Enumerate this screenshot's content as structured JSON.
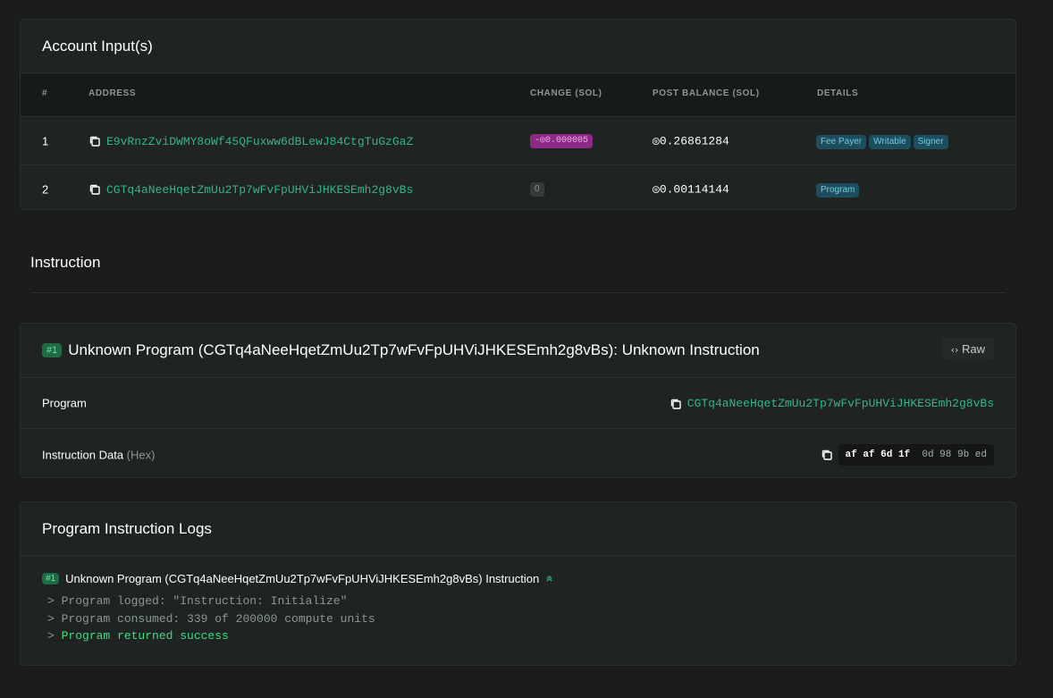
{
  "accounts": {
    "title": "Account Input(s)",
    "columns": [
      "#",
      "ADDRESS",
      "CHANGE (SOL)",
      "POST BALANCE (SOL)",
      "DETAILS"
    ],
    "rows": [
      {
        "index": "1",
        "address": "E9vRnzZviDWMY8oWf45QFuxww6dBLewJ84CtgTuGzGaZ",
        "change": "-◎0.000005",
        "post_balance": "◎0.26861284",
        "details": [
          "Fee Payer",
          "Writable",
          "Signer"
        ]
      },
      {
        "index": "2",
        "address": "CGTq4aNeeHqetZmUu2Tp7wFvFpUHViJHKESEmh2g8vBs",
        "change": "0",
        "post_balance": "◎0.00114144",
        "details": [
          "Program"
        ]
      }
    ]
  },
  "instruction_section": {
    "title": "Instruction"
  },
  "instruction": {
    "number": "#1",
    "title": "Unknown Program (CGTq4aNeeHqetZmUu2Tp7wFvFpUHViJHKESEmh2g8vBs): Unknown Instruction",
    "raw_label": "Raw",
    "program_label": "Program",
    "program_value": "CGTq4aNeeHqetZmUu2Tp7wFvFpUHViJHKESEmh2g8vBs",
    "data_label": "Instruction Data",
    "data_hint": "(Hex)",
    "data_bold": "af af 6d 1f",
    "data_rest": "0d 98 9b ed"
  },
  "logs": {
    "title": "Program Instruction Logs",
    "number": "#1",
    "heading": "Unknown Program (CGTq4aNeeHqetZmUu2Tp7wFvFpUHViJHKESEmh2g8vBs) Instruction",
    "lines": [
      {
        "prefix": "> ",
        "text": "Program logged: \"Instruction: Initialize\"",
        "status": "normal"
      },
      {
        "prefix": "> ",
        "text": "Program consumed: 339 of 200000 compute units",
        "status": "normal"
      },
      {
        "prefix": "> ",
        "text": "Program returned success",
        "status": "success"
      }
    ]
  },
  "colors": {
    "link": "#35b38b",
    "success": "#3ddc84",
    "change_negative": "#8c2a86"
  }
}
